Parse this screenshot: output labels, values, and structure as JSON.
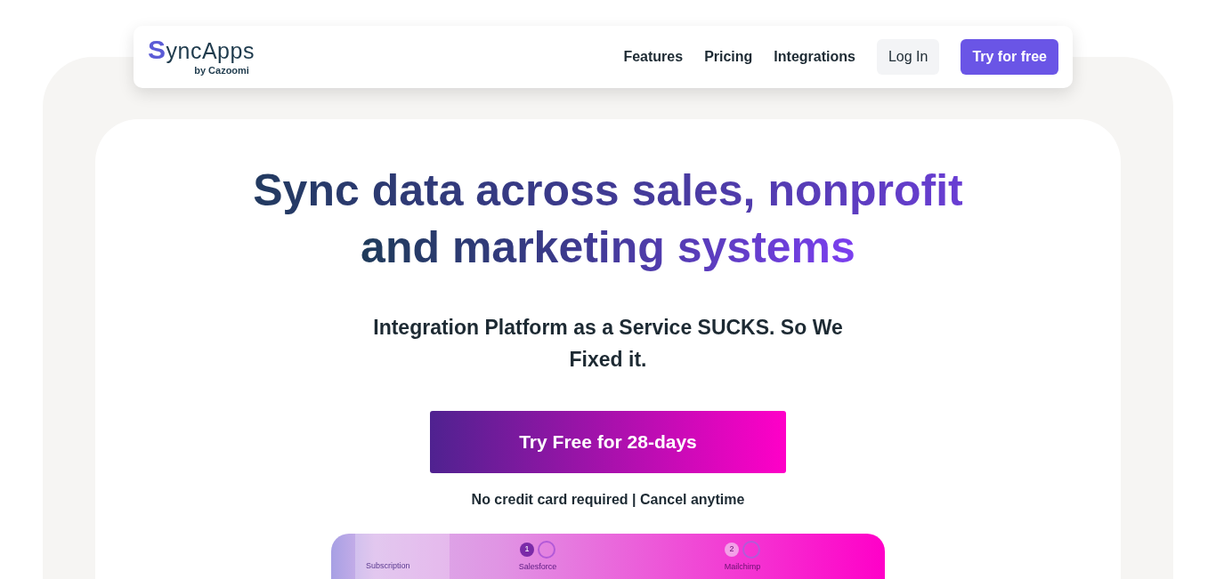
{
  "logo": {
    "name": "SyncApps",
    "byline": "by Cazoomi"
  },
  "nav": {
    "links": [
      "Features",
      "Pricing",
      "Integrations"
    ],
    "login": "Log In",
    "cta": "Try for free"
  },
  "hero": {
    "headline_lines": [
      "Sync data across sales, nonprofit",
      "and marketing systems"
    ],
    "subheadline": "Integration Platform as a Service SUCKS. So We Fixed it.",
    "cta": "Try Free for 28-days",
    "note": "No credit card required | Cancel anytime"
  },
  "preview": {
    "sidebar_item": "Subscription",
    "steps": [
      {
        "number": "1",
        "label": "Salesforce",
        "selected": true
      },
      {
        "number": "2",
        "label": "Mailchimp",
        "selected": false
      }
    ]
  }
}
